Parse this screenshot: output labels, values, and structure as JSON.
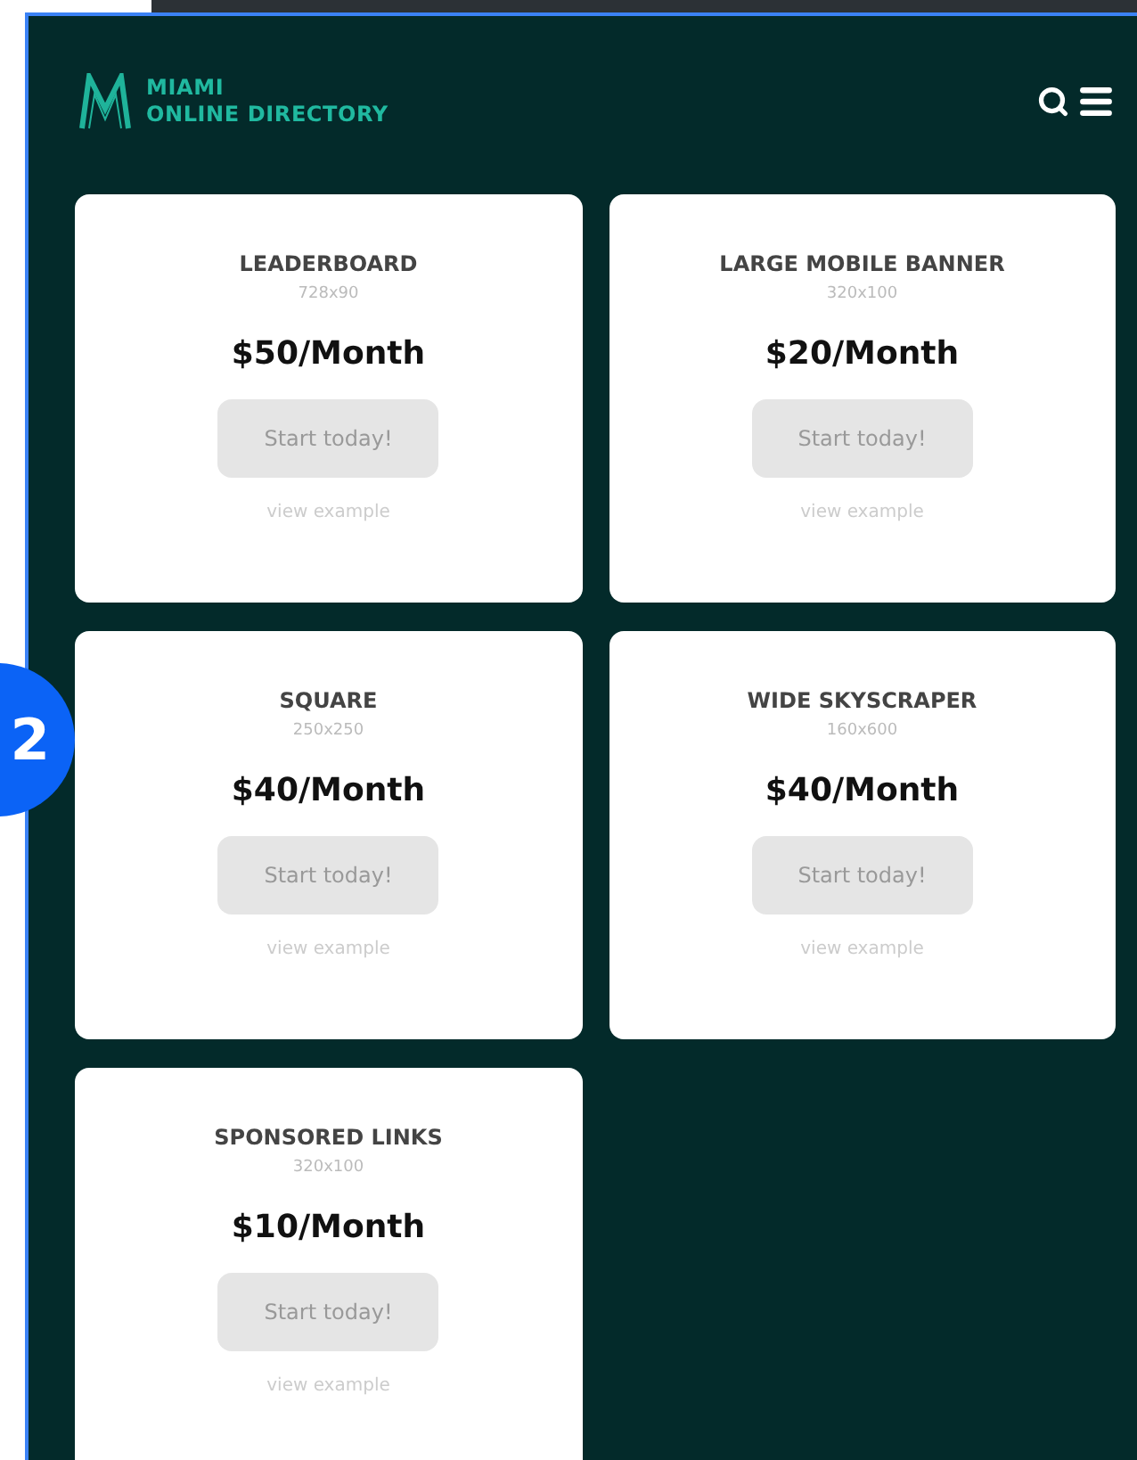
{
  "badge": {
    "number": "2"
  },
  "header": {
    "logo_line_1": "MIAMI",
    "logo_line_2": "ONLINE DIRECTORY"
  },
  "plans": [
    {
      "title": "LEADERBOARD",
      "size": "728x90",
      "price": "$50/Month",
      "button": "Start today!",
      "link": "view example"
    },
    {
      "title": "LARGE MOBILE BANNER",
      "size": "320x100",
      "price": "$20/Month",
      "button": "Start today!",
      "link": "view example"
    },
    {
      "title": "SQUARE",
      "size": "250x250",
      "price": "$40/Month",
      "button": "Start today!",
      "link": "view example"
    },
    {
      "title": "WIDE SKYSCRAPER",
      "size": "160x600",
      "price": "$40/Month",
      "button": "Start today!",
      "link": "view example"
    },
    {
      "title": "SPONSORED LINKS",
      "size": "320x100",
      "price": "$10/Month",
      "button": "Start today!",
      "link": "view example"
    }
  ]
}
